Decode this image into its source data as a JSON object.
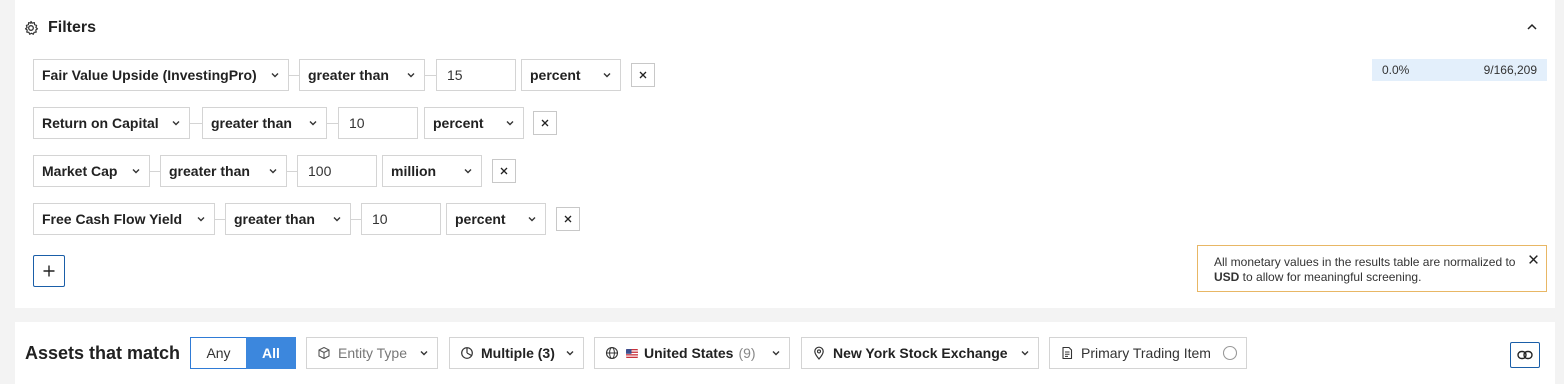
{
  "filters": {
    "title": "Filters",
    "rows": [
      {
        "metric": "Fair Value Upside (InvestingPro)",
        "operator": "greater than",
        "value": "15",
        "unit": "percent"
      },
      {
        "metric": "Return on Capital",
        "operator": "greater than",
        "value": "10",
        "unit": "percent"
      },
      {
        "metric": "Market Cap",
        "operator": "greater than",
        "value": "100",
        "unit": "million"
      },
      {
        "metric": "Free Cash Flow Yield",
        "operator": "greater than",
        "value": "10",
        "unit": "percent"
      }
    ],
    "stats": {
      "percent": "0.0%",
      "count": "9/166,209"
    },
    "notice": {
      "text_before": "All monetary values in the results table are normalized to ",
      "currency": "USD",
      "text_after": " to allow for meaningful screening."
    }
  },
  "assets": {
    "title": "Assets that match",
    "toggle": {
      "any": "Any",
      "all": "All",
      "selected": "All"
    },
    "entity_type": "Entity Type",
    "period": "Multiple (3)",
    "country": "United States",
    "country_count": "(9)",
    "exchange": "New York Stock Exchange",
    "primary": "Primary Trading Item"
  },
  "colors": {
    "accent": "#3c87dd",
    "notice_border": "#e8b765",
    "stat_bg": "#e3effb"
  }
}
